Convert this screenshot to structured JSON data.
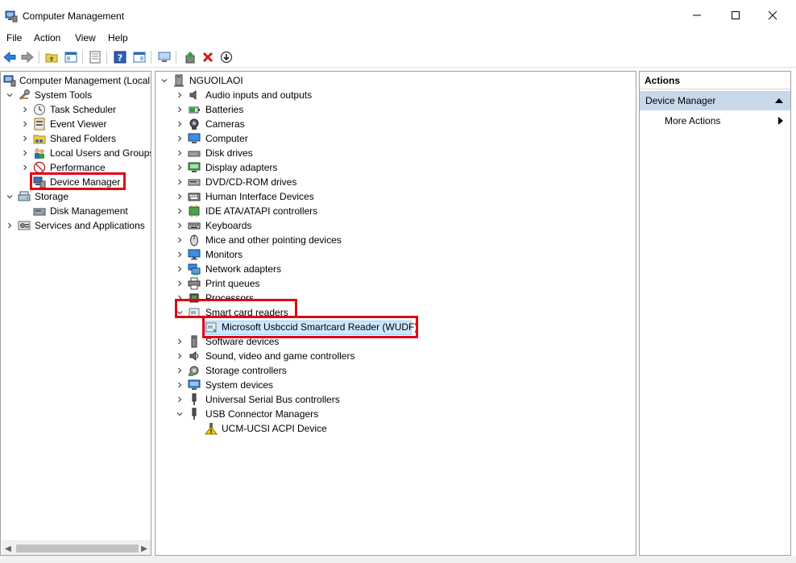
{
  "window": {
    "title": "Computer Management"
  },
  "menu": [
    "File",
    "Action",
    "View",
    "Help"
  ],
  "left_tree": {
    "root": "Computer Management (Local",
    "system_tools": "System Tools",
    "items": [
      "Task Scheduler",
      "Event Viewer",
      "Shared Folders",
      "Local Users and Groups",
      "Performance",
      "Device Manager"
    ],
    "storage": "Storage",
    "storage_items": [
      "Disk Management"
    ],
    "services": "Services and Applications"
  },
  "device_tree": {
    "computer_name": "NGUOILAOI",
    "categories": [
      "Audio inputs and outputs",
      "Batteries",
      "Cameras",
      "Computer",
      "Disk drives",
      "Display adapters",
      "DVD/CD-ROM drives",
      "Human Interface Devices",
      "IDE ATA/ATAPI controllers",
      "Keyboards",
      "Mice and other pointing devices",
      "Monitors",
      "Network adapters",
      "Print queues",
      "Processors",
      "Smart card readers",
      "Software devices",
      "Sound, video and game controllers",
      "Storage controllers",
      "System devices",
      "Universal Serial Bus controllers",
      "USB Connector Managers"
    ],
    "smart_card_child": "Microsoft Usbccid Smartcard Reader (WUDF)",
    "usb_connector_child": "UCM-UCSI ACPI Device"
  },
  "actions": {
    "title": "Actions",
    "section": "Device Manager",
    "more": "More Actions"
  },
  "colors": {
    "highlight": "#e30012",
    "selection": "#cce8ff",
    "actions_header": "#c7d8eb"
  }
}
